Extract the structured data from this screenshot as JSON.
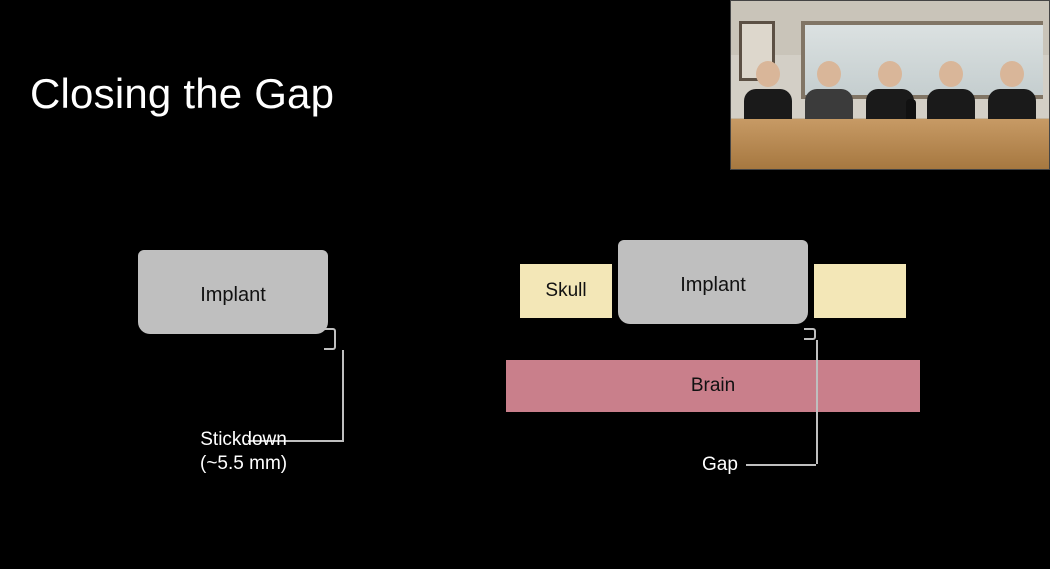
{
  "title": "Closing the Gap",
  "left_diagram": {
    "implant_label": "Implant",
    "stickdown_label_line1": "Stickdown",
    "stickdown_label_line2": "(~5.5 mm)"
  },
  "right_diagram": {
    "implant_label": "Implant",
    "skull_label": "Skull",
    "brain_label": "Brain",
    "gap_label": "Gap"
  },
  "colors": {
    "background": "#000000",
    "implant": "#bfbfbf",
    "skull": "#f3e7b7",
    "brain": "#c97f8b",
    "line": "#bfbfbf",
    "text_dark": "#111111",
    "text_light": "#ffffff"
  }
}
